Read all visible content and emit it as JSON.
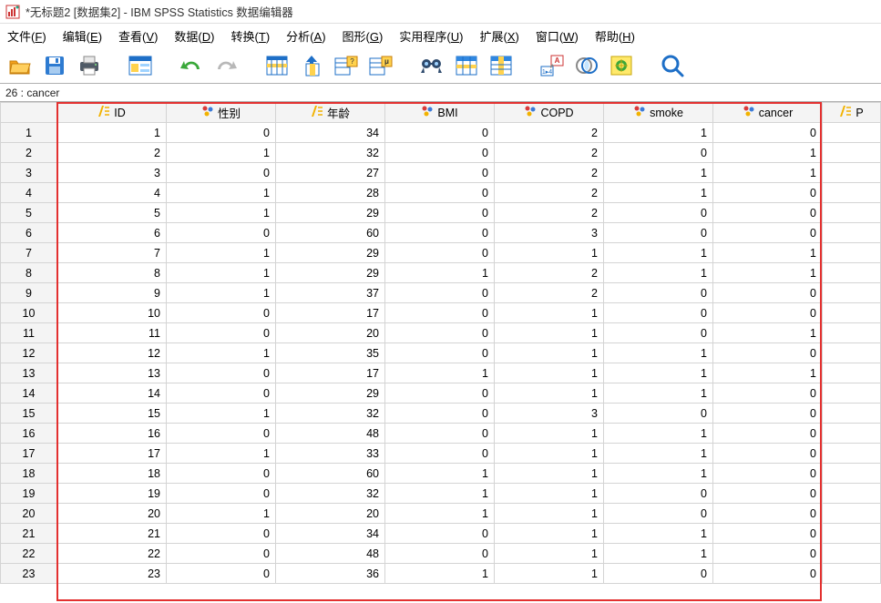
{
  "window": {
    "title": "*无标题2 [数据集2] - IBM SPSS Statistics 数据编辑器"
  },
  "menu": {
    "file": {
      "label": "文件",
      "accel": "F"
    },
    "edit": {
      "label": "编辑",
      "accel": "E"
    },
    "view": {
      "label": "查看",
      "accel": "V"
    },
    "data": {
      "label": "数据",
      "accel": "D"
    },
    "trans": {
      "label": "转换",
      "accel": "T"
    },
    "analyze": {
      "label": "分析",
      "accel": "A"
    },
    "graph": {
      "label": "图形",
      "accel": "G"
    },
    "util": {
      "label": "实用程序",
      "accel": "U"
    },
    "ext": {
      "label": "扩展",
      "accel": "X"
    },
    "window": {
      "label": "窗口",
      "accel": "W"
    },
    "help": {
      "label": "帮助",
      "accel": "H"
    }
  },
  "status": {
    "cell_ref": "26 : cancer"
  },
  "columns": [
    {
      "name": "ID",
      "type": "scale"
    },
    {
      "name": "性别",
      "type": "nominal"
    },
    {
      "name": "年龄",
      "type": "scale"
    },
    {
      "name": "BMI",
      "type": "nominal"
    },
    {
      "name": "COPD",
      "type": "nominal"
    },
    {
      "name": "smoke",
      "type": "nominal"
    },
    {
      "name": "cancer",
      "type": "nominal"
    },
    {
      "name": "P",
      "type": "scale"
    }
  ],
  "rows": [
    {
      "n": 1,
      "v": [
        "1",
        "0",
        "34",
        "0",
        "2",
        "1",
        "0"
      ]
    },
    {
      "n": 2,
      "v": [
        "2",
        "1",
        "32",
        "0",
        "2",
        "0",
        "1"
      ]
    },
    {
      "n": 3,
      "v": [
        "3",
        "0",
        "27",
        "0",
        "2",
        "1",
        "1"
      ]
    },
    {
      "n": 4,
      "v": [
        "4",
        "1",
        "28",
        "0",
        "2",
        "1",
        "0"
      ]
    },
    {
      "n": 5,
      "v": [
        "5",
        "1",
        "29",
        "0",
        "2",
        "0",
        "0"
      ]
    },
    {
      "n": 6,
      "v": [
        "6",
        "0",
        "60",
        "0",
        "3",
        "0",
        "0"
      ]
    },
    {
      "n": 7,
      "v": [
        "7",
        "1",
        "29",
        "0",
        "1",
        "1",
        "1"
      ]
    },
    {
      "n": 8,
      "v": [
        "8",
        "1",
        "29",
        "1",
        "2",
        "1",
        "1"
      ]
    },
    {
      "n": 9,
      "v": [
        "9",
        "1",
        "37",
        "0",
        "2",
        "0",
        "0"
      ]
    },
    {
      "n": 10,
      "v": [
        "10",
        "0",
        "17",
        "0",
        "1",
        "0",
        "0"
      ]
    },
    {
      "n": 11,
      "v": [
        "11",
        "0",
        "20",
        "0",
        "1",
        "0",
        "1"
      ]
    },
    {
      "n": 12,
      "v": [
        "12",
        "1",
        "35",
        "0",
        "1",
        "1",
        "0"
      ]
    },
    {
      "n": 13,
      "v": [
        "13",
        "0",
        "17",
        "1",
        "1",
        "1",
        "1"
      ]
    },
    {
      "n": 14,
      "v": [
        "14",
        "0",
        "29",
        "0",
        "1",
        "1",
        "0"
      ]
    },
    {
      "n": 15,
      "v": [
        "15",
        "1",
        "32",
        "0",
        "3",
        "0",
        "0"
      ]
    },
    {
      "n": 16,
      "v": [
        "16",
        "0",
        "48",
        "0",
        "1",
        "1",
        "0"
      ]
    },
    {
      "n": 17,
      "v": [
        "17",
        "1",
        "33",
        "0",
        "1",
        "1",
        "0"
      ]
    },
    {
      "n": 18,
      "v": [
        "18",
        "0",
        "60",
        "1",
        "1",
        "1",
        "0"
      ]
    },
    {
      "n": 19,
      "v": [
        "19",
        "0",
        "32",
        "1",
        "1",
        "0",
        "0"
      ]
    },
    {
      "n": 20,
      "v": [
        "20",
        "1",
        "20",
        "1",
        "1",
        "0",
        "0"
      ]
    },
    {
      "n": 21,
      "v": [
        "21",
        "0",
        "34",
        "0",
        "1",
        "1",
        "0"
      ]
    },
    {
      "n": 22,
      "v": [
        "22",
        "0",
        "48",
        "0",
        "1",
        "1",
        "0"
      ]
    },
    {
      "n": 23,
      "v": [
        "23",
        "0",
        "36",
        "1",
        "1",
        "0",
        "0"
      ]
    }
  ],
  "icons": {
    "open": "📂",
    "save": "💾",
    "print": "🖨️",
    "data_view": "▦",
    "undo": "↶",
    "redo": "↷",
    "goto": "⇲",
    "vars": "📊",
    "find": "🔍",
    "scale_color": "#f2b200",
    "nominal_colors": [
      "#d83b3b",
      "#3b7bd8",
      "#f2b200"
    ]
  }
}
